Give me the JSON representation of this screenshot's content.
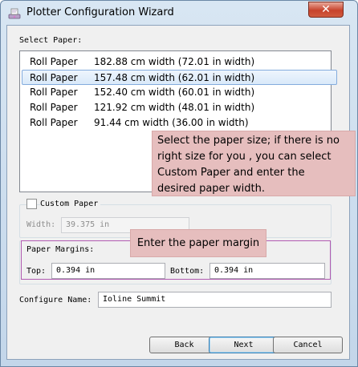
{
  "window": {
    "title": "Plotter Configuration Wizard",
    "close_label": "✕"
  },
  "select_paper": {
    "label": "Select Paper:",
    "items": [
      {
        "name": "Roll Paper",
        "size": "182.88 cm width (72.01 in width)"
      },
      {
        "name": "Roll Paper",
        "size": "157.48 cm width (62.01 in width)",
        "selected": true
      },
      {
        "name": "Roll Paper",
        "size": "152.40 cm width (60.01 in width)"
      },
      {
        "name": "Roll Paper",
        "size": "121.92 cm width (48.01 in width)"
      },
      {
        "name": "Roll Paper",
        "size": "91.44 cm width (36.00 in width)"
      }
    ]
  },
  "custom_paper": {
    "label": "Custom Paper",
    "checked": false,
    "width_label": "Width:",
    "width_value": "39.375 in"
  },
  "paper_margins": {
    "label": "Paper Margins:",
    "top_label": "Top:",
    "top_value": "0.394 in",
    "bottom_label": "Bottom:",
    "bottom_value": "0.394 in"
  },
  "configure_name": {
    "label": "Configure Name:",
    "value": "Ioline Summit"
  },
  "buttons": {
    "back": "Back",
    "next": "Next",
    "cancel": "Cancel"
  },
  "annotations": {
    "paper_size_lines": [
      "Select the paper size; if there is no",
      "right size for you , you can select",
      "Custom Paper and enter the",
      "desired paper width."
    ],
    "paper_margin": "Enter the paper margin"
  },
  "colors": {
    "selection": "#d9e9f9",
    "callout": "#e6bebe",
    "margin_box": "#b15ab1",
    "close_button": "#c7432c"
  }
}
